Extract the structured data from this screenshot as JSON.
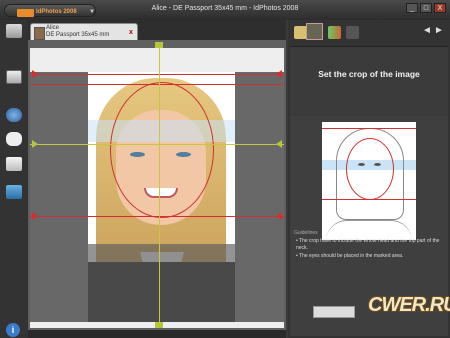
{
  "window": {
    "title": "Alice - DE Passport 35x45 mm - IdPhotos 2008",
    "app_name": "IdPhotos",
    "app_version": "2008",
    "minimize": "_",
    "maximize": "□",
    "close": "X"
  },
  "document_tab": {
    "line1": "Alice",
    "line2": "DE Passport 35x45 mm",
    "close": "x"
  },
  "right_panel": {
    "nav_back": "◄",
    "nav_forward": "►",
    "title": "Set the crop of the image",
    "guidelines_label": "Guidelines",
    "guidelines": [
      "• The crop have to include the whole head and the top part of the neck.",
      "• The eyes should be placed in the marked area."
    ]
  },
  "info_button": "i",
  "watermark": "CWER.RU",
  "colors": {
    "background": "#3a3a3a",
    "accent_orange": "#e88b2a",
    "guide_red": "#d23030",
    "guide_yellow": "#c8c840",
    "eye_band": "#c8e1f5"
  },
  "icons": {
    "left_toolbar": [
      "person-card-icon",
      "id-cards-icon",
      "globe-tools-icon",
      "chat-icon",
      "edit-icon",
      "book-icon"
    ],
    "right_toolbar": [
      "folder-icon",
      "portrait-icon",
      "play-icon",
      "user-grey-icon"
    ]
  }
}
